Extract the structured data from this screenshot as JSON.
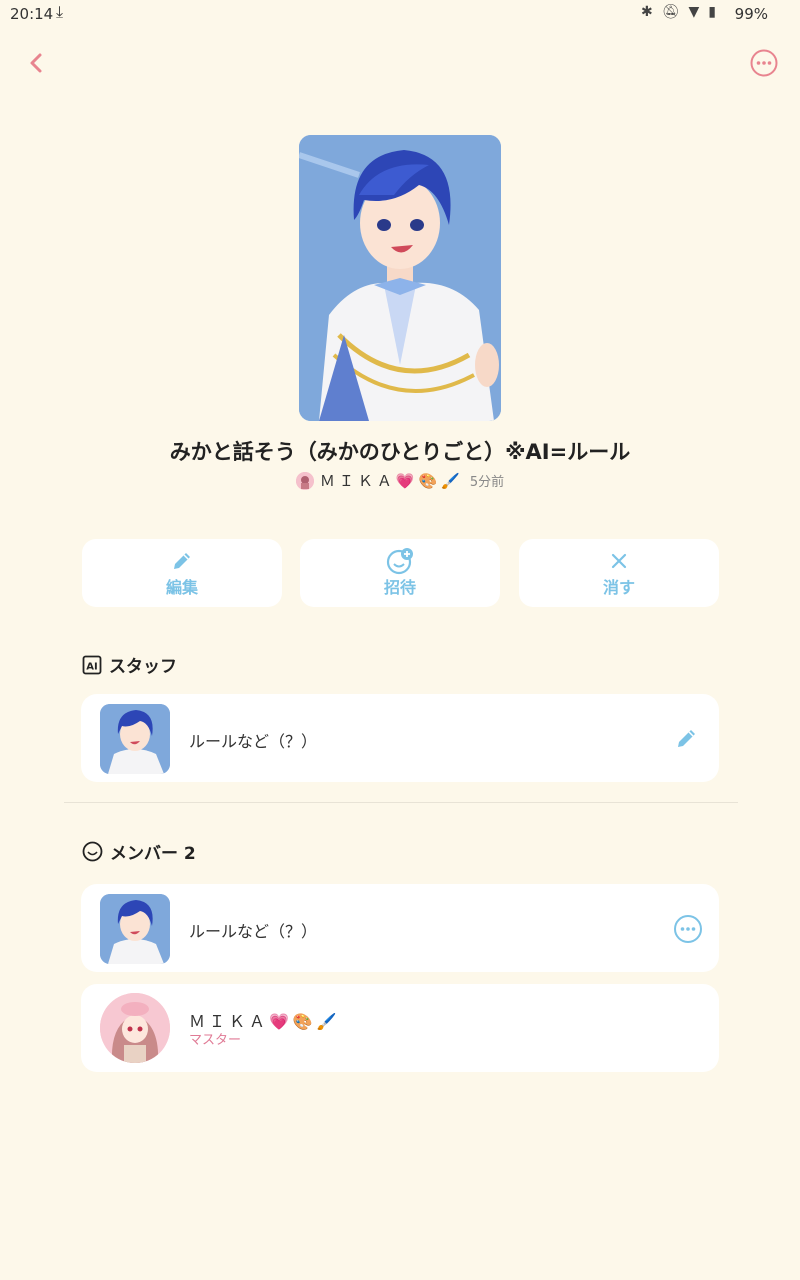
{
  "status_bar": {
    "time": "20:14",
    "battery": "99%"
  },
  "room": {
    "title": "みかと話そう（みかのひとりごと）※AI=ルール",
    "owner_name": "ＭＩＫＡ💗🎨🖌️",
    "posted_ago": "5分前"
  },
  "actions": {
    "edit_label": "編集",
    "invite_label": "招待",
    "delete_label": "消す"
  },
  "staff_section": {
    "title": "スタッフ",
    "badge": "AI",
    "items": [
      {
        "name": "ルールなど（？）"
      }
    ]
  },
  "member_section": {
    "title": "メンバー 2",
    "items": [
      {
        "name": "ルールなど（？）"
      },
      {
        "name": "ＭＩＫＡ💗🎨🖌️",
        "role": "マスター"
      }
    ]
  },
  "colors": {
    "background": "#fdf8ea",
    "accent_blue": "#7cc3e6",
    "accent_pink": "#e07a95"
  }
}
